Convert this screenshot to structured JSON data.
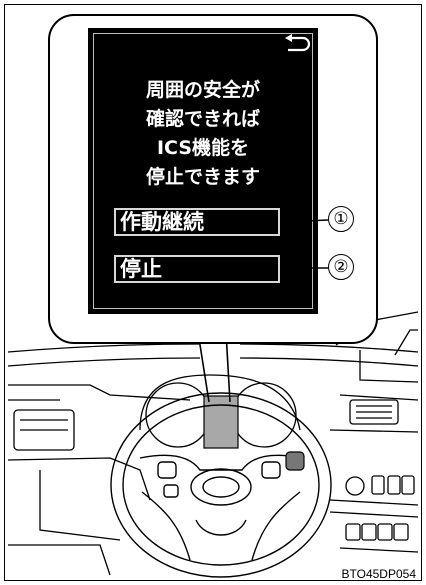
{
  "screen": {
    "message_lines": [
      "周囲の安全が",
      "確認できれば",
      "ICS機能を",
      "停止できます"
    ],
    "buttons": [
      {
        "label": "作動継続",
        "callout": "①"
      },
      {
        "label": "停止",
        "callout": "②"
      }
    ],
    "back_icon": "return-arrow-icon"
  },
  "figure_code": "BTO45DP054",
  "colors": {
    "screen_bg": "#000000",
    "screen_text": "#ffffff",
    "highlight": "#a8a8a8",
    "line_art": "#000000"
  }
}
